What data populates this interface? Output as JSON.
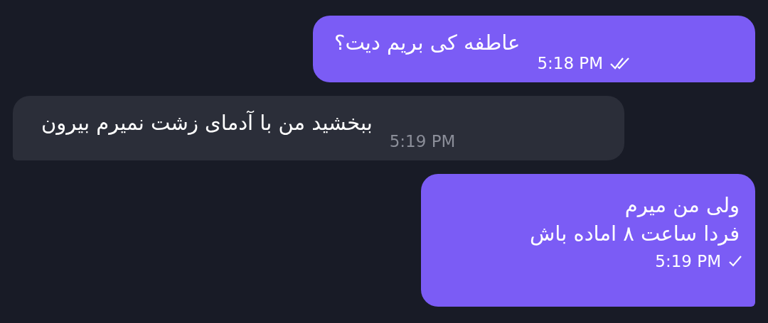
{
  "messages": [
    {
      "kind": "outgoing",
      "lines": [
        "عاطفه کی بریم دیت؟"
      ],
      "time": "5:18 PM",
      "read": true
    },
    {
      "kind": "incoming",
      "lines": [
        "ببخشید من با آدمای زشت نمیرم بیرون"
      ],
      "time": "5:19 PM"
    },
    {
      "kind": "outgoing",
      "lines": [
        "ولی من میرم",
        "فردا ساعت ۸ اماده باش"
      ],
      "time": "5:19 PM",
      "read": false
    }
  ]
}
